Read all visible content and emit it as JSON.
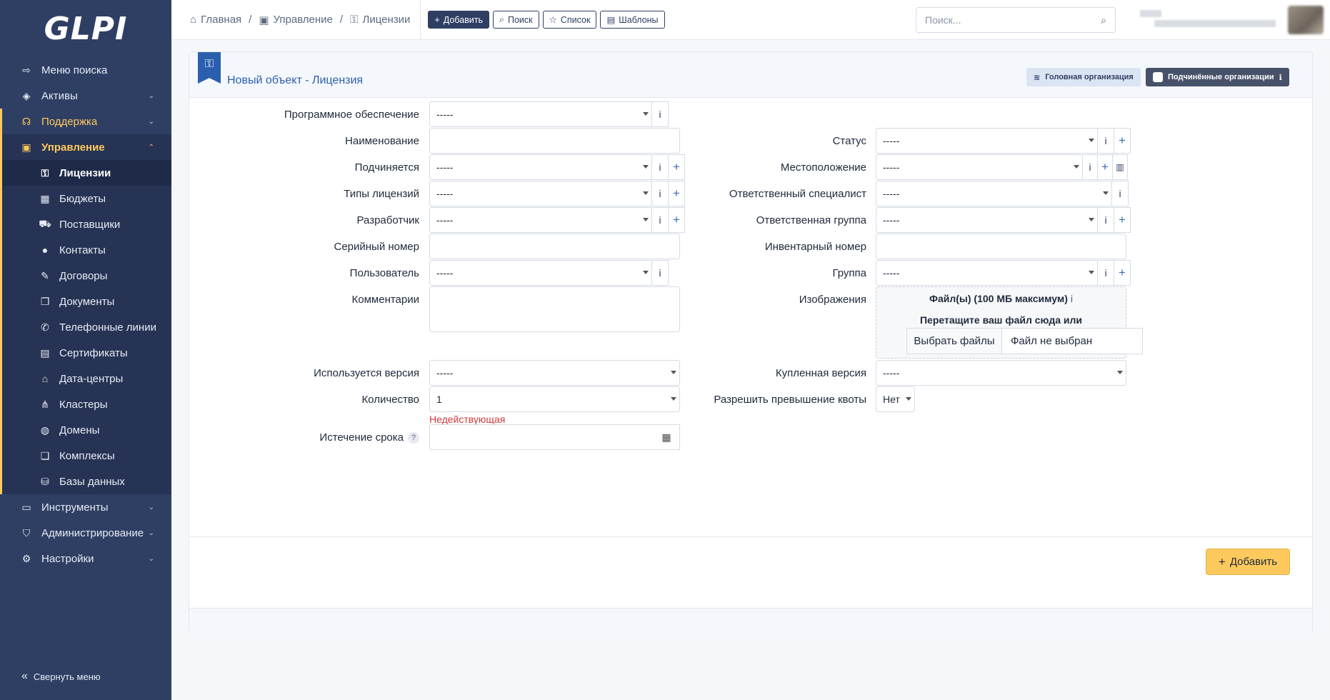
{
  "app": {
    "logo": "GLPI"
  },
  "sidebar": {
    "items": [
      {
        "label": "Меню поиска",
        "icon": "arrow-right-icon"
      },
      {
        "label": "Активы",
        "icon": "box-icon"
      },
      {
        "label": "Поддержка",
        "icon": "headset-icon"
      },
      {
        "label": "Управление",
        "icon": "wallet-icon"
      }
    ],
    "sub_items": [
      {
        "label": "Лицензии",
        "icon": "key-icon"
      },
      {
        "label": "Бюджеты",
        "icon": "calculator-icon"
      },
      {
        "label": "Поставщики",
        "icon": "truck-icon"
      },
      {
        "label": "Контакты",
        "icon": "user-icon"
      },
      {
        "label": "Договоры",
        "icon": "contract-icon"
      },
      {
        "label": "Документы",
        "icon": "documents-icon"
      },
      {
        "label": "Телефонные линии",
        "icon": "phone-icon"
      },
      {
        "label": "Сертификаты",
        "icon": "certificate-icon"
      },
      {
        "label": "Дата-центры",
        "icon": "building-icon"
      },
      {
        "label": "Кластеры",
        "icon": "cluster-icon"
      },
      {
        "label": "Домены",
        "icon": "globe-icon"
      },
      {
        "label": "Комплексы",
        "icon": "copy-icon"
      },
      {
        "label": "Базы данных",
        "icon": "database-icon"
      }
    ],
    "bottom_items": [
      {
        "label": "Инструменты",
        "icon": "briefcase-icon"
      },
      {
        "label": "Администрирование",
        "icon": "shield-icon"
      },
      {
        "label": "Настройки",
        "icon": "gear-icon"
      }
    ],
    "collapse_label": "Свернуть меню"
  },
  "header": {
    "breadcrumbs": [
      "Главная",
      "Управление",
      "Лицензии"
    ],
    "buttons": [
      "Добавить",
      "Поиск",
      "Список",
      "Шаблоны"
    ],
    "search_placeholder": "Поиск..."
  },
  "form": {
    "title": "Новый объект - Лицензия",
    "entity_head": "Головная организация",
    "entity_sub": "Подчинённые организации",
    "empty": "-----",
    "left": {
      "software": "Программное обеспечение",
      "name": "Наименование",
      "parent": "Подчиняется",
      "license_types": "Типы лицензий",
      "manufacturer": "Разработчик",
      "serial": "Серийный номер",
      "user": "Пользователь",
      "comments": "Комментарии",
      "version_use": "Используется версия",
      "quantity": "Количество",
      "quantity_value": "1",
      "inactive": "Недействующая",
      "expiration": "Истечение срока"
    },
    "right": {
      "status": "Статус",
      "location": "Местоположение",
      "tech": "Ответственный специалист",
      "tech_group": "Ответственная группа",
      "inventory": "Инвентарный номер",
      "group": "Группа",
      "images": "Изображения",
      "files_label": "Файл(ы) (100 МБ максимум)",
      "drop_label": "Перетащите ваш файл сюда или",
      "choose_files": "Выбрать файлы",
      "no_file": "Файл не выбран",
      "version_buy": "Купленная версия",
      "allow_over": "Разрешить превышение квоты",
      "allow_over_value": "Нет"
    },
    "submit": "Добавить"
  }
}
